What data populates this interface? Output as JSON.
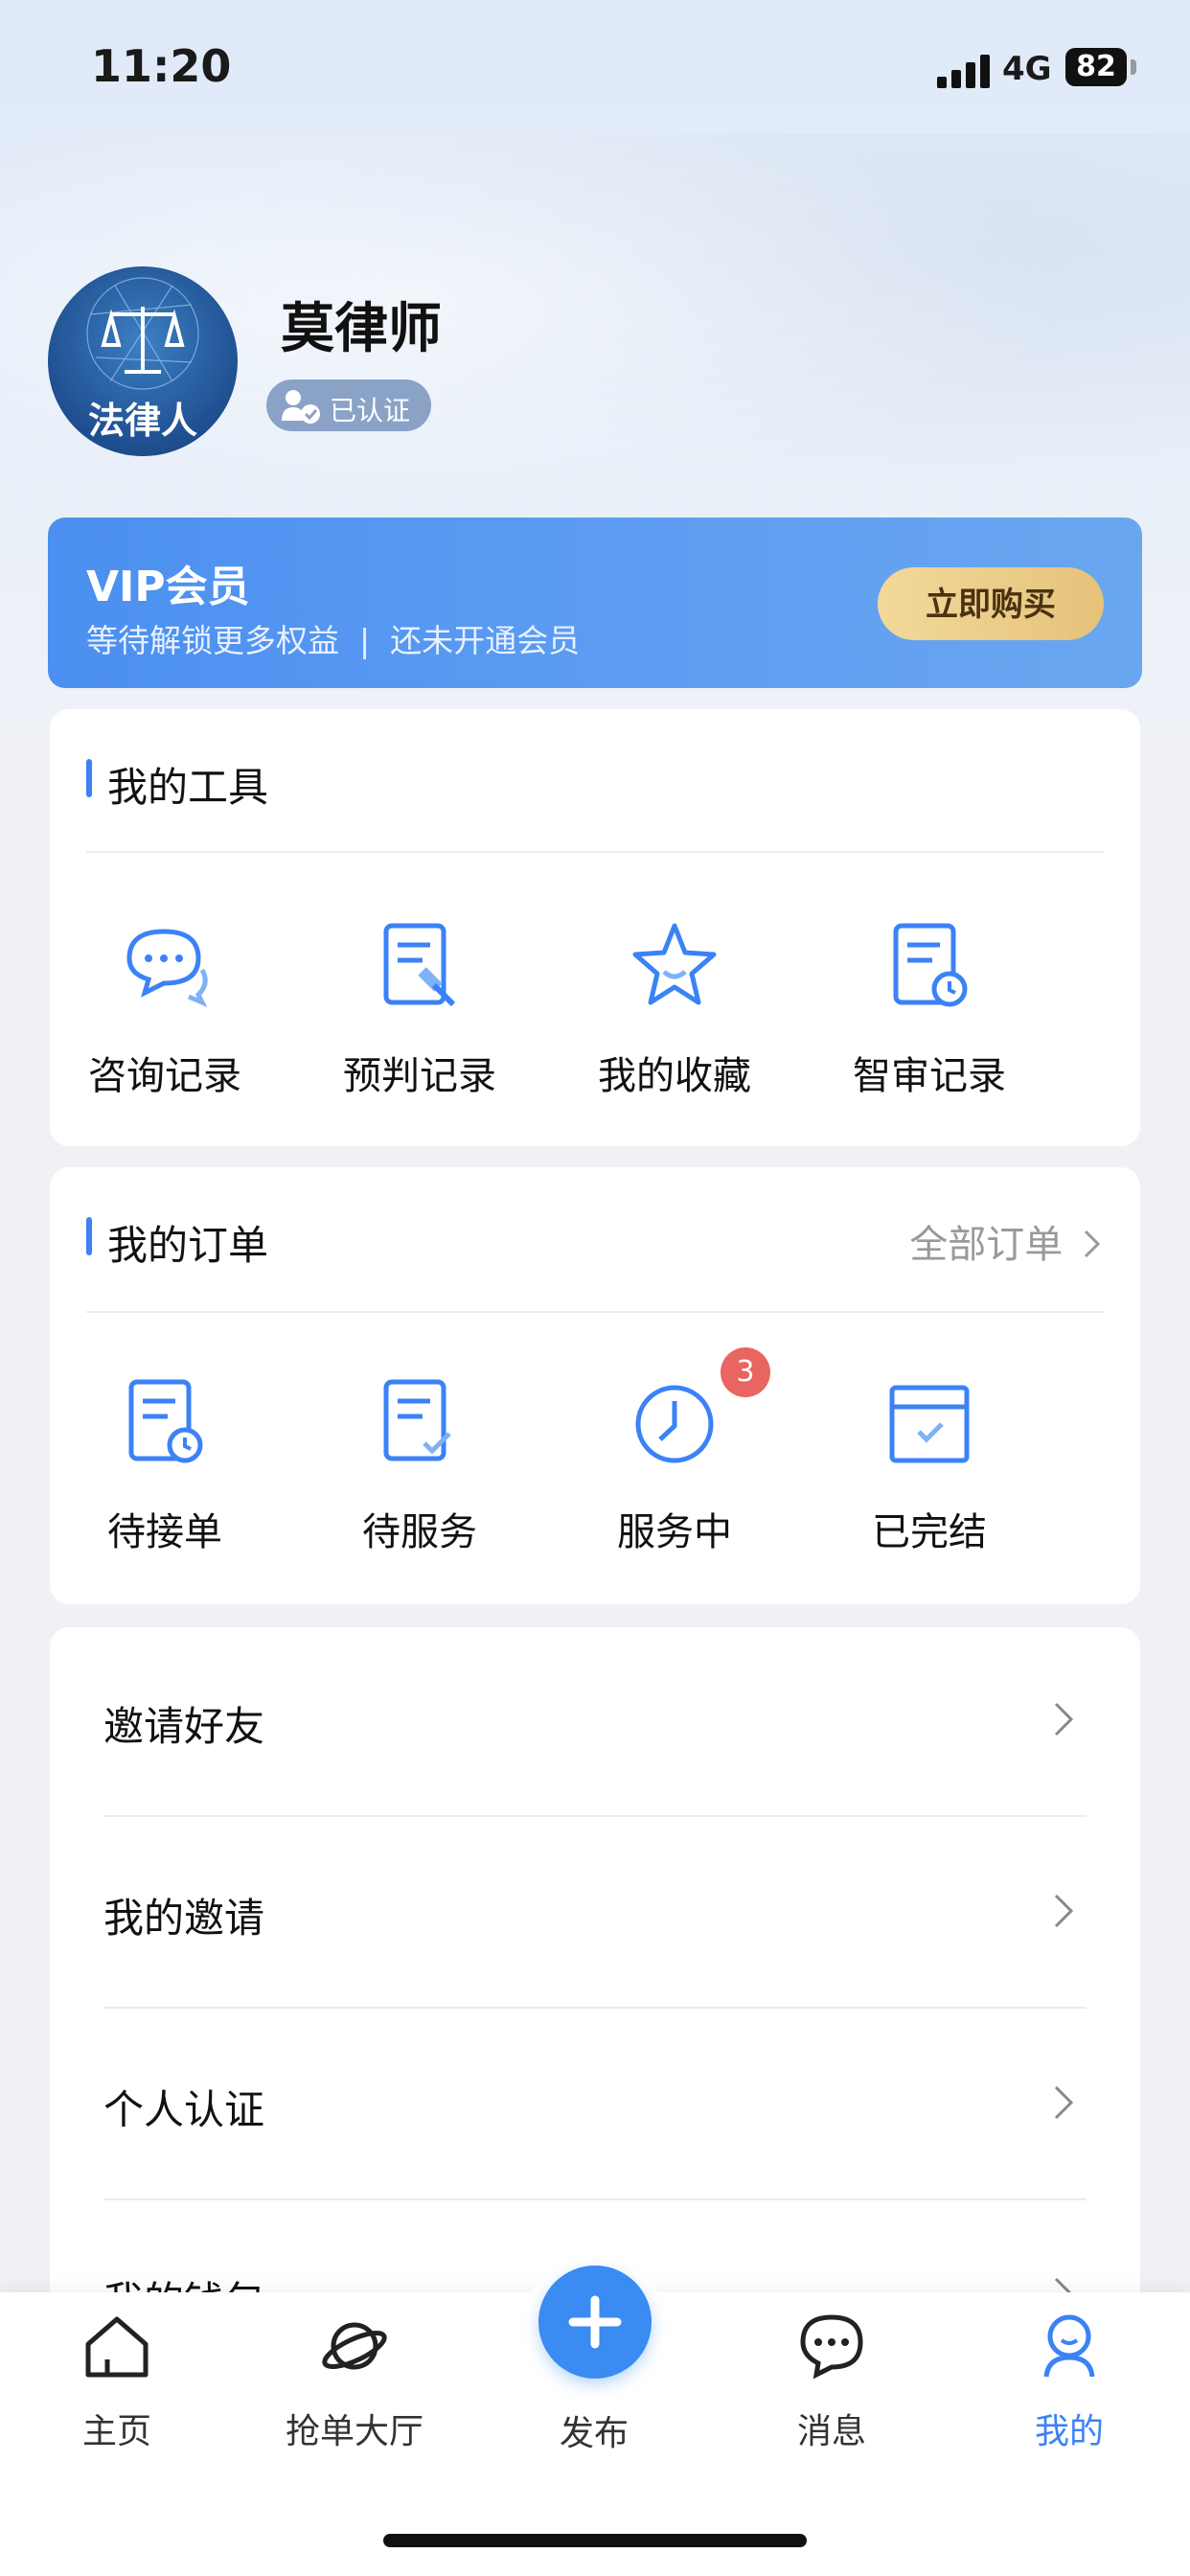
{
  "status_bar": {
    "time": "11:20",
    "network": "4G",
    "battery": "82"
  },
  "profile": {
    "avatar_text": "法律人",
    "name": "莫律师",
    "verified_label": "已认证"
  },
  "vip": {
    "title": "VIP会员",
    "subtitle": "等待解锁更多权益  |  还未开通会员",
    "button": "立即购买"
  },
  "tools": {
    "title": "我的工具",
    "items": [
      {
        "label": "咨询记录",
        "icon": "chat-bubbles-icon"
      },
      {
        "label": "预判记录",
        "icon": "document-gavel-icon"
      },
      {
        "label": "我的收藏",
        "icon": "star-icon"
      },
      {
        "label": "智审记录",
        "icon": "document-clock-icon"
      }
    ]
  },
  "orders": {
    "title": "我的订单",
    "all_link": "全部订单",
    "items": [
      {
        "label": "待接单",
        "icon": "document-clock-icon"
      },
      {
        "label": "待服务",
        "icon": "document-check-icon"
      },
      {
        "label": "服务中",
        "icon": "clock-icon",
        "badge": "3"
      },
      {
        "label": "已完结",
        "icon": "calendar-check-icon"
      }
    ]
  },
  "menu": {
    "items": [
      {
        "label": "邀请好友"
      },
      {
        "label": "我的邀请"
      },
      {
        "label": "个人认证"
      },
      {
        "label": "我的钱包"
      }
    ]
  },
  "tabbar": {
    "items": [
      {
        "label": "主页",
        "icon": "home-icon"
      },
      {
        "label": "抢单大厅",
        "icon": "planet-icon"
      },
      {
        "label": "发布",
        "icon": "plus-icon"
      },
      {
        "label": "消息",
        "icon": "message-icon"
      },
      {
        "label": "我的",
        "icon": "user-icon"
      }
    ],
    "active": "我的"
  },
  "colors": {
    "accent": "#3b82f6",
    "vip_gold": "#e6c27a",
    "badge": "#e86561"
  }
}
